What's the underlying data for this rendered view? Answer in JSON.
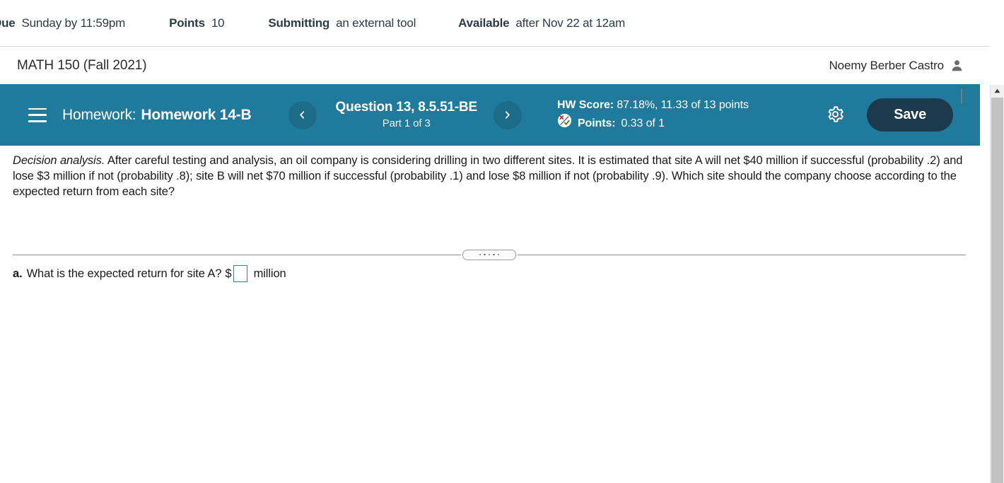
{
  "lms_banner": {
    "due_label": "Due",
    "due_value": "Sunday by 11:59pm",
    "points_label": "Points",
    "points_value": "10",
    "submitting_label": "Submitting",
    "submitting_value": "an external tool",
    "available_label": "Available",
    "available_value": "after Nov 22 at 12am"
  },
  "course_header": {
    "course_title": "MATH 150 (Fall 2021)",
    "user_name": "Noemy Berber Castro",
    "avatar_icon": "user-icon"
  },
  "toolbar": {
    "menu_icon": "hamburger-menu-icon",
    "assignment_label": "Homework:",
    "assignment_name": "Homework 14-B",
    "prev_icon": "chevron-left-icon",
    "next_icon": "chevron-right-icon",
    "question_id": "Question 13, 8.5.51-BE",
    "question_part": "Part 1 of 3",
    "hw_score_label": "HW Score:",
    "hw_score_value": "87.18%, 11.33 of 13 points",
    "points_icon": "partial-credit-icon",
    "points_label": "Points:",
    "points_value": "0.33 of 1",
    "settings_icon": "gear-icon",
    "save_label": "Save",
    "accent_color": "#1f7a9b",
    "save_color": "#1b3a4b"
  },
  "question": {
    "topic": "Decision analysis.",
    "text": " After careful testing and analysis, an oil company is considering drilling in two different sites. It is estimated that site A will net $40 million if successful (probability .2) and lose $3 million if not (probability .8); site B will net $70 million if successful (probability .1) and lose $8 million if not (probability .9). Which site should the company choose according to the expected return from each site?"
  },
  "splitter": {
    "handle_icon": "drag-handle-icon"
  },
  "answer": {
    "letter": "a.",
    "prompt": "What is the expected return for site A?",
    "currency": "$",
    "input_value": "",
    "input_placeholder": "",
    "unit": "million"
  },
  "scrollbar": {
    "up_icon": "scroll-up-arrow-icon"
  }
}
